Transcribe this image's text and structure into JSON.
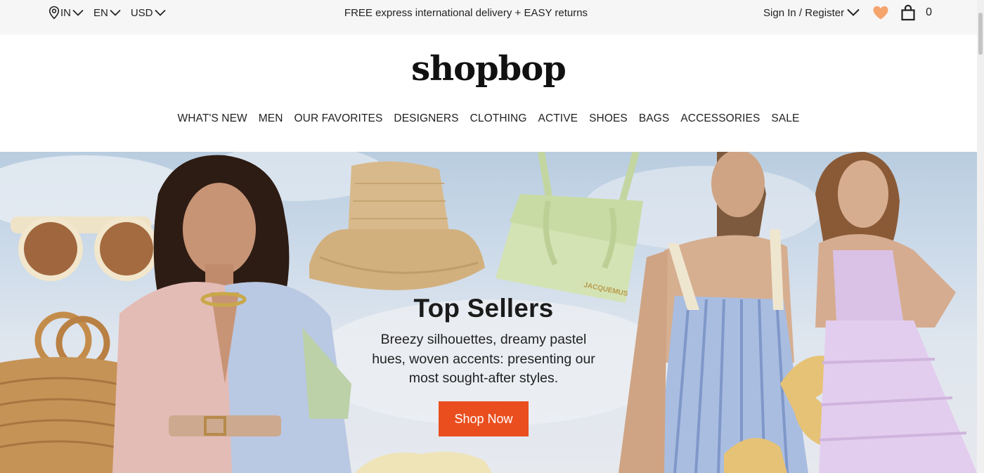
{
  "topbar": {
    "country": "IN",
    "language": "EN",
    "currency": "USD",
    "promo": "FREE express international delivery + EASY returns",
    "signin": "Sign In / Register",
    "cart_count": "0",
    "heart_color": "#f5a46e"
  },
  "header": {
    "logo": "shopbop"
  },
  "nav": {
    "items": [
      "WHAT'S NEW",
      "MEN",
      "OUR FAVORITES",
      "DESIGNERS",
      "CLOTHING",
      "ACTIVE",
      "SHOES",
      "BAGS",
      "ACCESSORIES",
      "SALE"
    ]
  },
  "hero": {
    "title": "Top Sellers",
    "subtitle": "Breezy silhouettes, dreamy pastel hues, woven accents: presenting our most sought-after styles.",
    "cta": "Shop Now",
    "cta_color": "#ea4e1f",
    "bag_brand": "JACQUEMUS"
  }
}
